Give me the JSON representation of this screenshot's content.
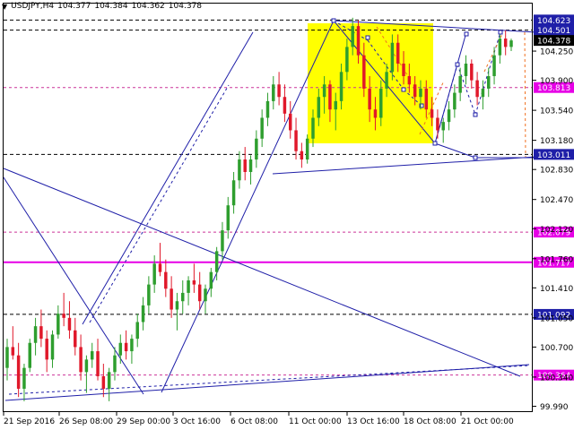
{
  "header": {
    "symbol": "USDJPY,H4",
    "open": "104.377",
    "high": "104.384",
    "low": "104.362",
    "close": "104.378",
    "collapse_glyph": "▼"
  },
  "colors": {
    "bull": "#2e9e2e",
    "bear": "#e0182a",
    "blue_line": "#1f1fa8",
    "pink": "#e600e6",
    "pink_dash": "#cc3399",
    "orange": "#f07020",
    "yellow": "#ffff00",
    "grid": "#000000"
  },
  "chart_data": {
    "type": "candlestick",
    "ylim": [
      99.99,
      104.8
    ],
    "y_ticks": [
      "104.250",
      "103.900",
      "103.540",
      "103.180",
      "102.830",
      "102.470",
      "102.120",
      "101.760",
      "101.410",
      "101.050",
      "100.700",
      "100.340",
      "99.990"
    ],
    "x_ticks": [
      "21 Sep 2016",
      "26 Sep 08:00",
      "29 Sep 00:00",
      "3 Oct 16:00",
      "6 Oct 08:00",
      "11 Oct 00:00",
      "13 Oct 16:00",
      "18 Oct 08:00",
      "21 Oct 00:00"
    ],
    "levels": [
      {
        "label": "104.623",
        "value": 104.623,
        "style": "dash-black",
        "badge": "#1f1fa8"
      },
      {
        "label": "104.501",
        "value": 104.501,
        "style": "dash-black",
        "badge": "#1f1fa8"
      },
      {
        "label": "104.378",
        "value": 104.378,
        "style": "none",
        "badge": "#000000"
      },
      {
        "label": "103.813",
        "value": 103.813,
        "style": "dash-pink",
        "badge": "#e600e6"
      },
      {
        "label": "103.011",
        "value": 103.011,
        "style": "dash-black",
        "badge": "#1f1fa8"
      },
      {
        "label": "102.079",
        "value": 102.079,
        "style": "dash-pink",
        "badge": "#e600e6"
      },
      {
        "label": "101.717",
        "value": 101.717,
        "style": "solid-pink",
        "badge": "#e600e6"
      },
      {
        "label": "101.092",
        "value": 101.092,
        "style": "dash-black",
        "badge": "#1f1fa8"
      },
      {
        "label": "100.364",
        "value": 100.364,
        "style": "dash-pink",
        "badge": "#e600e6"
      }
    ],
    "candles": [
      [
        100.45,
        100.8,
        100.3,
        100.7
      ],
      [
        100.7,
        100.95,
        100.55,
        100.6
      ],
      [
        100.6,
        100.75,
        100.1,
        100.2
      ],
      [
        100.2,
        100.5,
        100.05,
        100.45
      ],
      [
        100.45,
        100.8,
        100.4,
        100.75
      ],
      [
        100.75,
        101.05,
        100.6,
        100.95
      ],
      [
        100.95,
        101.15,
        100.7,
        100.8
      ],
      [
        100.8,
        100.9,
        100.4,
        100.55
      ],
      [
        100.55,
        100.9,
        100.45,
        100.85
      ],
      [
        100.85,
        101.2,
        100.8,
        101.1
      ],
      [
        101.1,
        101.35,
        100.95,
        101.05
      ],
      [
        101.05,
        101.25,
        100.8,
        100.9
      ],
      [
        100.9,
        101.05,
        100.6,
        100.7
      ],
      [
        100.7,
        100.85,
        100.3,
        100.4
      ],
      [
        100.4,
        100.6,
        100.15,
        100.55
      ],
      [
        100.55,
        100.75,
        100.45,
        100.65
      ],
      [
        100.65,
        100.8,
        100.3,
        100.35
      ],
      [
        100.35,
        100.5,
        100.1,
        100.2
      ],
      [
        100.2,
        100.45,
        100.05,
        100.4
      ],
      [
        100.4,
        100.7,
        100.3,
        100.6
      ],
      [
        100.6,
        100.85,
        100.5,
        100.75
      ],
      [
        100.75,
        100.9,
        100.55,
        100.65
      ],
      [
        100.65,
        100.85,
        100.5,
        100.8
      ],
      [
        100.8,
        101.1,
        100.7,
        101.0
      ],
      [
        101.0,
        101.3,
        100.9,
        101.2
      ],
      [
        101.2,
        101.55,
        101.1,
        101.45
      ],
      [
        101.45,
        101.8,
        101.35,
        101.7
      ],
      [
        101.7,
        101.95,
        101.55,
        101.6
      ],
      [
        101.6,
        101.75,
        101.3,
        101.4
      ],
      [
        101.4,
        101.55,
        101.05,
        101.15
      ],
      [
        101.15,
        101.35,
        100.9,
        101.25
      ],
      [
        101.25,
        101.5,
        101.1,
        101.35
      ],
      [
        101.35,
        101.55,
        101.2,
        101.5
      ],
      [
        101.5,
        101.7,
        101.35,
        101.45
      ],
      [
        101.45,
        101.6,
        101.15,
        101.25
      ],
      [
        101.25,
        101.45,
        101.1,
        101.4
      ],
      [
        101.4,
        101.65,
        101.3,
        101.6
      ],
      [
        101.6,
        101.9,
        101.5,
        101.85
      ],
      [
        101.85,
        102.2,
        101.75,
        102.1
      ],
      [
        102.1,
        102.5,
        102.0,
        102.4
      ],
      [
        102.4,
        102.8,
        102.3,
        102.7
      ],
      [
        102.7,
        103.05,
        102.6,
        102.95
      ],
      [
        102.95,
        103.1,
        102.7,
        102.8
      ],
      [
        102.8,
        103.0,
        102.65,
        102.95
      ],
      [
        102.95,
        103.3,
        102.85,
        103.2
      ],
      [
        103.2,
        103.55,
        103.1,
        103.45
      ],
      [
        103.45,
        103.75,
        103.35,
        103.65
      ],
      [
        103.65,
        103.95,
        103.55,
        103.85
      ],
      [
        103.85,
        104.0,
        103.6,
        103.7
      ],
      [
        103.7,
        103.85,
        103.4,
        103.5
      ],
      [
        103.5,
        103.65,
        103.2,
        103.3
      ],
      [
        103.3,
        103.45,
        102.95,
        103.05
      ],
      [
        103.05,
        103.15,
        102.85,
        102.95
      ],
      [
        102.95,
        103.25,
        102.9,
        103.2
      ],
      [
        103.2,
        103.55,
        103.1,
        103.45
      ],
      [
        103.45,
        103.8,
        103.35,
        103.7
      ],
      [
        103.7,
        103.95,
        103.5,
        103.85
      ],
      [
        103.85,
        103.9,
        103.4,
        103.55
      ],
      [
        103.55,
        103.75,
        103.3,
        103.65
      ],
      [
        103.65,
        104.1,
        103.55,
        104.0
      ],
      [
        104.0,
        104.4,
        103.9,
        104.3
      ],
      [
        104.3,
        104.65,
        104.2,
        104.55
      ],
      [
        104.55,
        104.62,
        104.1,
        104.2
      ],
      [
        104.2,
        104.35,
        103.7,
        103.8
      ],
      [
        103.8,
        103.95,
        103.4,
        103.55
      ],
      [
        103.55,
        103.7,
        103.3,
        103.45
      ],
      [
        103.45,
        103.9,
        103.35,
        103.8
      ],
      [
        103.8,
        104.1,
        103.7,
        104.0
      ],
      [
        104.0,
        104.45,
        103.9,
        104.35
      ],
      [
        104.35,
        104.45,
        104.0,
        104.1
      ],
      [
        104.1,
        104.25,
        103.85,
        103.95
      ],
      [
        103.95,
        104.1,
        103.75,
        103.85
      ],
      [
        103.85,
        103.95,
        103.6,
        103.7
      ],
      [
        103.7,
        103.9,
        103.55,
        103.8
      ],
      [
        103.8,
        103.9,
        103.45,
        103.55
      ],
      [
        103.55,
        103.7,
        103.35,
        103.45
      ],
      [
        103.45,
        103.55,
        103.2,
        103.3
      ],
      [
        103.3,
        103.45,
        103.15,
        103.4
      ],
      [
        103.4,
        103.65,
        103.3,
        103.55
      ],
      [
        103.55,
        103.85,
        103.45,
        103.75
      ],
      [
        103.75,
        104.05,
        103.65,
        103.95
      ],
      [
        103.95,
        104.2,
        103.85,
        104.1
      ],
      [
        104.1,
        104.15,
        103.8,
        103.9
      ],
      [
        103.9,
        104.0,
        103.6,
        103.7
      ],
      [
        103.7,
        103.9,
        103.55,
        103.8
      ],
      [
        103.8,
        104.05,
        103.7,
        103.95
      ],
      [
        103.95,
        104.3,
        103.85,
        104.2
      ],
      [
        104.2,
        104.45,
        104.1,
        104.4
      ],
      [
        104.4,
        104.5,
        104.2,
        104.3
      ],
      [
        104.3,
        104.4,
        104.25,
        104.378
      ]
    ]
  }
}
